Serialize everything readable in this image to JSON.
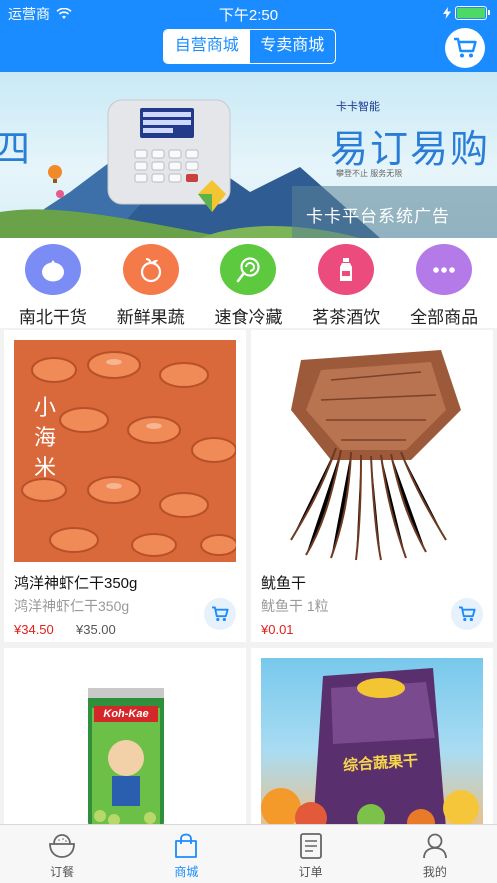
{
  "status": {
    "carrier": "运营商",
    "time": "下午2:50"
  },
  "header": {
    "segments": [
      {
        "label": "自营商城",
        "active": true
      },
      {
        "label": "专卖商城",
        "active": false
      }
    ],
    "cart_icon": "cart-icon"
  },
  "banner": {
    "brand": "卡卡智能",
    "slogan": "易订易购",
    "slogan_sub": "攀登不止  服务无限",
    "caption": "卡卡平台系统广告"
  },
  "categories": [
    {
      "label": "南北干货",
      "icon": "tomato-icon",
      "color": "#7b8cf5"
    },
    {
      "label": "新鲜果蔬",
      "icon": "fruit-icon",
      "color": "#f47a4a"
    },
    {
      "label": "速食冷藏",
      "icon": "lollipop-icon",
      "color": "#5cc93e"
    },
    {
      "label": "茗茶酒饮",
      "icon": "bottle-icon",
      "color": "#ec4b7e"
    },
    {
      "label": "全部商品",
      "icon": "more-icon",
      "color": "#b47ae8"
    }
  ],
  "products": [
    {
      "name": "鸿洋神虾仁干350g",
      "sub": "鸿洋神虾仁干350g",
      "price": "¥34.50",
      "original_price": "¥35.00",
      "img_text": "小海米"
    },
    {
      "name": "鱿鱼干",
      "sub": "鱿鱼干 1粒",
      "price": "¥0.01",
      "original_price": ""
    },
    {
      "name": "",
      "sub": "",
      "price": "",
      "original_price": "",
      "img_text": "Koh-Kae"
    },
    {
      "name": "",
      "sub": "",
      "price": "",
      "original_price": "",
      "img_text": "综合蔬果干"
    }
  ],
  "tabs": [
    {
      "label": "订餐",
      "icon": "bowl-icon",
      "active": false
    },
    {
      "label": "商城",
      "icon": "shopping-bag-icon",
      "active": true
    },
    {
      "label": "订单",
      "icon": "order-list-icon",
      "active": false
    },
    {
      "label": "我的",
      "icon": "person-icon",
      "active": false
    }
  ],
  "colors": {
    "primary": "#1a8cff",
    "price": "#e0201c"
  }
}
